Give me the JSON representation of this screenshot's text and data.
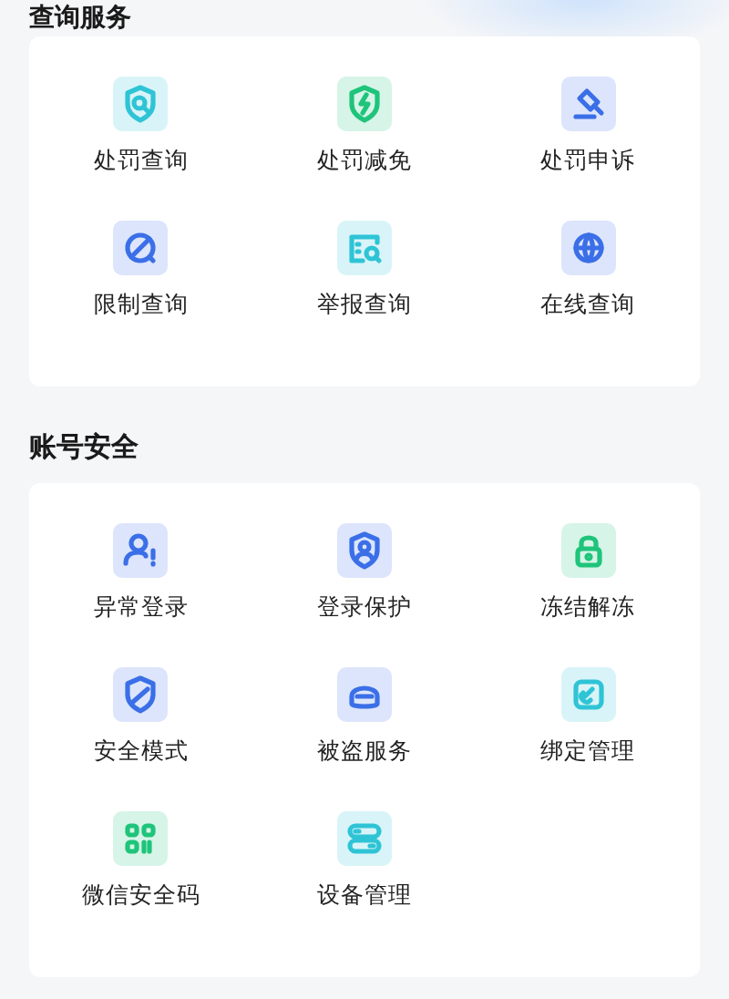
{
  "sections": [
    {
      "title": "查询服务",
      "items": [
        {
          "label": "处罚查询",
          "color": "#2ec4d6"
        },
        {
          "label": "处罚减免",
          "color": "#1ec47a"
        },
        {
          "label": "处罚申诉",
          "color": "#3b6fe8"
        },
        {
          "label": "限制查询",
          "color": "#3b6fe8"
        },
        {
          "label": "举报查询",
          "color": "#2ec4d6"
        },
        {
          "label": "在线查询",
          "color": "#3b6fe8"
        }
      ]
    },
    {
      "title": "账号安全",
      "items": [
        {
          "label": "异常登录",
          "color": "#3b6fe8"
        },
        {
          "label": "登录保护",
          "color": "#3b6fe8"
        },
        {
          "label": "冻结解冻",
          "color": "#1ec47a"
        },
        {
          "label": "安全模式",
          "color": "#3b6fe8"
        },
        {
          "label": "被盗服务",
          "color": "#3b6fe8"
        },
        {
          "label": "绑定管理",
          "color": "#2ec4d6"
        },
        {
          "label": "微信安全码",
          "color": "#1ec47a"
        },
        {
          "label": "设备管理",
          "color": "#2ec4d6"
        }
      ]
    }
  ]
}
